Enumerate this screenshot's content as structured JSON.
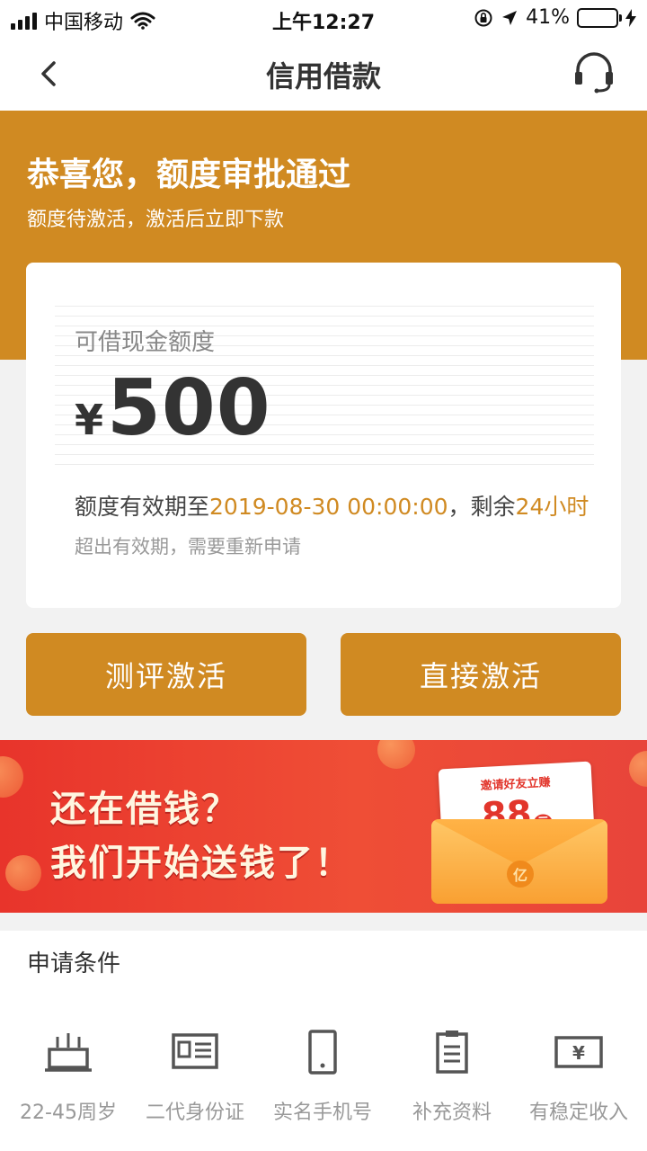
{
  "status_bar": {
    "carrier": "中国移动",
    "time": "上午12:27",
    "battery_percent": "41%",
    "battery_level": 0.41,
    "battery_color": "#4cd964"
  },
  "nav": {
    "title": "信用借款",
    "back_icon": "chevron-left-icon",
    "service_icon": "headset-icon"
  },
  "banner": {
    "title": "恭喜您，额度审批通过",
    "subtitle": "额度待激活，激活后立即下款",
    "color": "#d08a22"
  },
  "credit_card": {
    "label": "可借现金额度",
    "currency": "¥",
    "amount": "500",
    "validity_prefix": "额度有效期至",
    "validity_date": "2019-08-30 00:00:00",
    "validity_mid": "，剩余",
    "validity_remaining": "24小时",
    "note": "超出有效期，需要重新申请"
  },
  "buttons": {
    "evaluate": "测评激活",
    "direct": "直接激活"
  },
  "promo": {
    "line1": "还在借钱？",
    "line2": "我们开始送钱了！",
    "invite": "邀请好友立赚",
    "amount": "88",
    "unit": "元",
    "seal": "亿"
  },
  "conditions": {
    "title": "申请条件",
    "items": [
      {
        "label": "22-45周岁",
        "icon": "cake-icon"
      },
      {
        "label": "二代身份证",
        "icon": "id-card-icon"
      },
      {
        "label": "实名手机号",
        "icon": "phone-icon"
      },
      {
        "label": "补充资料",
        "icon": "clipboard-icon"
      },
      {
        "label": "有稳定收入",
        "icon": "yen-bill-icon"
      }
    ]
  }
}
